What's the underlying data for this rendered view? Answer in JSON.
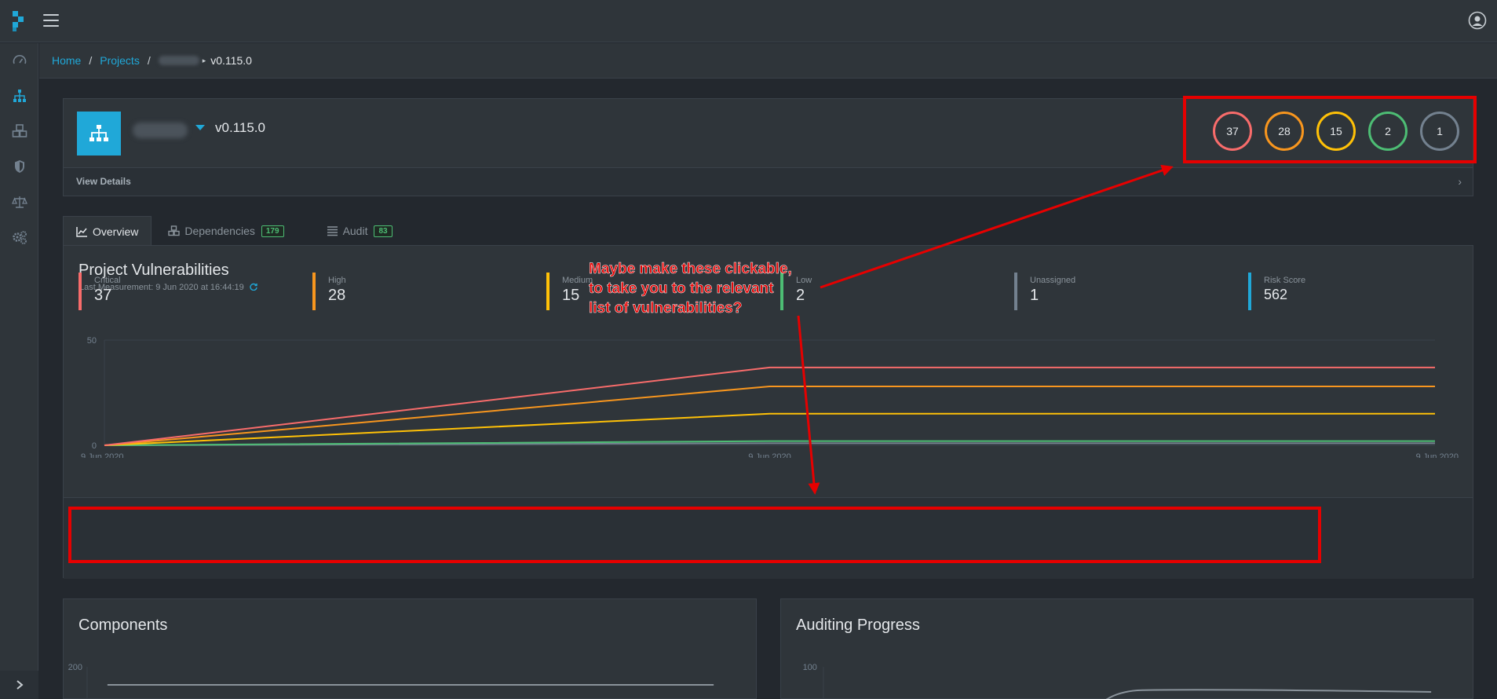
{
  "breadcrumb": {
    "home": "Home",
    "projects": "Projects",
    "version": "v0.115.0"
  },
  "project": {
    "version": "v0.115.0",
    "view_details": "View Details"
  },
  "severity_counts": [
    {
      "value": "37",
      "color": "#f86c6b"
    },
    {
      "value": "28",
      "color": "#f8961e"
    },
    {
      "value": "15",
      "color": "#ffc107"
    },
    {
      "value": "2",
      "color": "#4dbd74"
    },
    {
      "value": "1",
      "color": "#73818f"
    }
  ],
  "tabs": [
    {
      "label": "Overview",
      "badge": ""
    },
    {
      "label": "Dependencies",
      "badge": "179"
    },
    {
      "label": "Audit",
      "badge": "83"
    }
  ],
  "panel": {
    "title": "Project Vulnerabilities",
    "subtitle": "Last Measurement: 9 Jun 2020 at 16:44:19"
  },
  "chart_data": {
    "type": "line",
    "x": [
      "9 Jun 2020",
      "9 Jun 2020",
      "9 Jun 2020"
    ],
    "y_ticks": [
      "50",
      "0"
    ],
    "ylim": [
      0,
      50
    ],
    "series": [
      {
        "values": [
          0,
          37,
          37
        ],
        "color": "#f86c6b"
      },
      {
        "values": [
          0,
          28,
          28
        ],
        "color": "#f8961e"
      },
      {
        "values": [
          0,
          15,
          15
        ],
        "color": "#ffc107"
      },
      {
        "values": [
          0,
          2,
          2
        ],
        "color": "#4dbd74"
      },
      {
        "values": [
          0,
          1,
          1
        ],
        "color": "#73818f"
      }
    ]
  },
  "metrics": [
    {
      "label": "Critical",
      "value": "37",
      "color": "#f86c6b"
    },
    {
      "label": "High",
      "value": "28",
      "color": "#f8961e"
    },
    {
      "label": "Medium",
      "value": "15",
      "color": "#ffc107"
    },
    {
      "label": "Low",
      "value": "2",
      "color": "#4dbd74"
    },
    {
      "label": "Unassigned",
      "value": "1",
      "color": "#73818f"
    },
    {
      "label": "Risk Score",
      "value": "562",
      "color": "#20a8d8"
    }
  ],
  "annotation": {
    "line1": "Maybe make these clickable,",
    "line2": "to take you to the relevant",
    "line3": "list of vulnerabilities?"
  },
  "components": {
    "title": "Components",
    "y_tick": "200"
  },
  "auditing": {
    "title": "Auditing Progress",
    "y_tick": "100"
  }
}
